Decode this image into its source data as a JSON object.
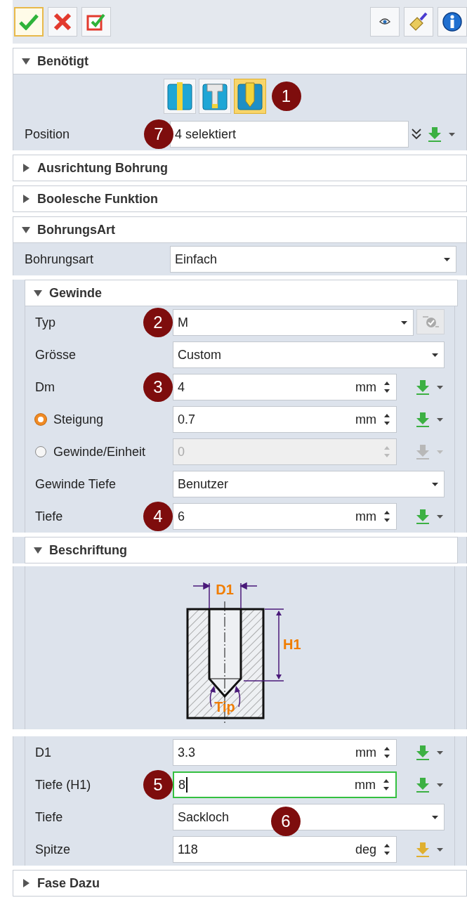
{
  "toolbar": {
    "left": [
      {
        "kind": "ok",
        "selected": true
      },
      {
        "kind": "cancel",
        "selected": false
      },
      {
        "kind": "apply",
        "selected": false
      }
    ],
    "right": [
      {
        "kind": "eye"
      },
      {
        "kind": "brush"
      },
      {
        "kind": "info"
      }
    ]
  },
  "sections": [
    {
      "title": "Benötigt",
      "expanded": true,
      "hole_types": [
        {
          "kind": "simple",
          "selected": false
        },
        {
          "kind": "counterbore",
          "selected": false
        },
        {
          "kind": "threaded",
          "selected": true,
          "badge": "1"
        }
      ],
      "rows": [
        {
          "kind": "selection",
          "label": "Position",
          "value": "4 selektiert",
          "badge": "7"
        }
      ]
    },
    {
      "title": "Ausrichtung Bohrung",
      "expanded": false
    },
    {
      "title": "Boolesche Funktion",
      "expanded": false
    },
    {
      "title": "BohrungsArt",
      "expanded": true,
      "rows": [
        {
          "kind": "dropdown",
          "label": "Bohrungsart",
          "value": "Einfach"
        }
      ],
      "subsections": [
        {
          "title": "Gewinde",
          "expanded": true,
          "rows": [
            {
              "kind": "dropdown_toggle",
              "label": "Typ",
              "value": "M",
              "badge": "2"
            },
            {
              "kind": "dropdown",
              "label": "Grösse",
              "value": "Custom"
            },
            {
              "kind": "number",
              "label": "Dm",
              "value": "4",
              "unit": "mm",
              "color": "#3cb043",
              "badge": "3"
            },
            {
              "kind": "number",
              "label": "Steigung",
              "value": "0.7",
              "unit": "mm",
              "color": "#3cb043",
              "radio": {
                "selected": true
              }
            },
            {
              "kind": "number",
              "label": "Gewinde/Einheit",
              "value": "0",
              "color": "#b8b8b8",
              "disabled": true,
              "radio": {
                "selected": false
              }
            },
            {
              "kind": "dropdown",
              "label": "Gewinde Tiefe",
              "value": "Benutzer"
            },
            {
              "kind": "number",
              "label": "Tiefe",
              "value": "6",
              "unit": "mm",
              "color": "#3cb043",
              "badge": "4"
            }
          ]
        },
        {
          "title": "Beschriftung",
          "expanded": true,
          "diagram": {
            "labels": [
              "D1",
              "H1",
              "Tip"
            ]
          },
          "rows": [
            {
              "kind": "number",
              "label": "D1",
              "value": "3.3",
              "unit": "mm",
              "color": "#3cb043"
            },
            {
              "kind": "number",
              "label": "Tiefe (H1)",
              "value": "8",
              "unit": "mm",
              "color": "#3cb043",
              "focused": true,
              "badge": "5"
            },
            {
              "kind": "dropdown",
              "label": "Tiefe",
              "value": "Sackloch",
              "badge": "6"
            },
            {
              "kind": "number",
              "label": "Spitze",
              "value": "118",
              "unit": "deg",
              "color": "#e0b030"
            }
          ]
        }
      ]
    },
    {
      "title": "Fase Dazu",
      "expanded": false
    }
  ]
}
